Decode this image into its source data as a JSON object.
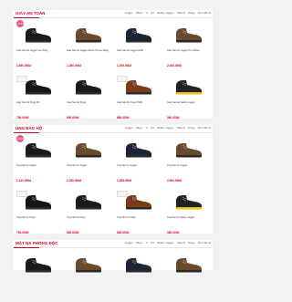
{
  "tabs": [
    "Jogger",
    "Ziben",
    "Yi",
    "UV",
    "Safety Jogger",
    "Takumi",
    "Kings",
    "Xem tất cả"
  ],
  "sections": [
    {
      "title": "GIÀY AN TOÀN",
      "discount": "-13%"
    },
    {
      "title": "ỦNG BẢO HỘ",
      "discount": "-13%"
    },
    {
      "title": "MẶT NẠ PHÒNG ĐỘC",
      "discount": ""
    }
  ],
  "products_1": [
    {
      "name": "Giày bảo hộ Jogger Lao động",
      "price": "1.550.000đ",
      "color": "#1b1b1b"
    },
    {
      "name": "Giày bảo hộ Jogger Zanmi S3 Lao động",
      "price": "1.250.000đ",
      "color": "#6a4a2c"
    },
    {
      "name": "Giày bảo hộ Jogger ESD",
      "price": "1.295.000đ",
      "color": "#1b2535"
    },
    {
      "name": "Giày bảo hộ Jogger Pro Ultima",
      "price": "2.000.000đ",
      "color": "#6a4a2c"
    },
    {
      "name": "Giày bảo hộ Kings KR",
      "price": "790.000đ",
      "color": "#161616"
    },
    {
      "name": "Giày bảo hộ Kings",
      "price": "690.000đ",
      "color": "#1a1a1a"
    },
    {
      "name": "Giày bảo hộ Kings KWD",
      "price": "680.000đ",
      "color": "#7a3b1a"
    },
    {
      "name": "Giày bảo hộ Safety Jogger",
      "price": "360.000đ",
      "color": "#222222"
    }
  ],
  "products_2": [
    {
      "name": "Ủng bảo hộ Jogger",
      "price": "1.120.000đ",
      "color": "#1b1b1b"
    },
    {
      "name": "Ủng bảo hộ Jogger",
      "price": "1.250.000đ",
      "color": "#6a4a2c"
    },
    {
      "name": "Ủng bảo hộ Jogger",
      "price": "1.295.000đ",
      "color": "#1b2535"
    },
    {
      "name": "Ủng bảo hộ Jogger",
      "price": "2.000.000đ",
      "color": "#6a4a2c"
    },
    {
      "name": "Ủng bảo hộ Kings",
      "price": "790.000đ",
      "color": "#161616"
    },
    {
      "name": "Ủng bảo hộ Kings",
      "price": "690.000đ",
      "color": "#1a1a1a"
    },
    {
      "name": "Ủng bảo hộ Kings",
      "price": "680.000đ",
      "color": "#7a3b1a"
    },
    {
      "name": "Ủng bảo hộ Safety Jogger",
      "price": "360.000đ",
      "color": "#222222"
    }
  ],
  "products_3": [
    {
      "name": "",
      "price": "",
      "color": "#1b1b1b"
    },
    {
      "name": "",
      "price": "",
      "color": "#6a4a2c"
    },
    {
      "name": "",
      "price": "",
      "color": "#1b2535"
    },
    {
      "name": "",
      "price": "",
      "color": "#6a4a2c"
    }
  ],
  "colors": {
    "accent": "#d0021b",
    "badge": "#e85a86",
    "yellow": "#f1c40f"
  }
}
